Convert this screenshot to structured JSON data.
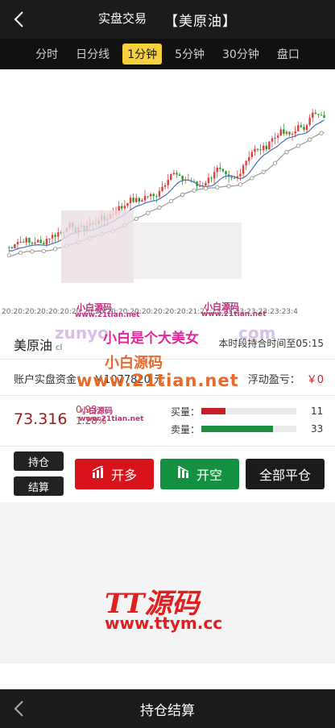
{
  "header": {
    "title": "实盘交易",
    "product": "【美原油】"
  },
  "tabs": [
    {
      "label": "分时",
      "active": false
    },
    {
      "label": "日分线",
      "active": false
    },
    {
      "label": "1分钟",
      "active": true
    },
    {
      "label": "5分钟",
      "active": false
    },
    {
      "label": "30分钟",
      "active": false
    },
    {
      "label": "盘口",
      "active": false
    }
  ],
  "chart_data": {
    "type": "candlestick",
    "x_tick_label_text": "20:20:20:20:20:20:20:20:20:20:20:20:20:20:20:20:21:21:23:23:23:23:23:23:23:4",
    "up_color": "#e03d3d",
    "down_color": "#2a9a2a"
  },
  "watermarks": {
    "a": "小白源码",
    "b": "www.21tian.net",
    "c": "zunyo",
    "d": "小白是个大美女",
    "e": "com",
    "f": "小白源码",
    "g": "www.21tian.net",
    "h": "小白源码",
    "i": "www.21tian.net",
    "j": "小白源码",
    "k": "www.21tian.net",
    "l": "TT源码",
    "m": "www.ttym.cc"
  },
  "info": {
    "name": "美原油",
    "code": "cl",
    "hold_time": "本时段持合时间至05:15",
    "fund_label": "账户实盘资金：",
    "fund_value": "￥1077820 元",
    "pnl_label": "浮动盈亏：",
    "pnl_value": "￥0",
    "price": "73.316",
    "change": "0.93",
    "change_pct": "1.28%",
    "buy_label": "买量：",
    "buy_value": "11",
    "buy_ratio": 0.25,
    "sell_label": "卖量：",
    "sell_value": "33",
    "sell_ratio": 0.75
  },
  "buttons": {
    "hold": "持仓",
    "settle": "结算",
    "long": "开多",
    "short": "开空",
    "close_all": "全部平仓"
  },
  "footer": {
    "title": "持仓结算"
  },
  "colors": {
    "accent_yellow": "#f5d13d",
    "long_red": "#d8131c",
    "short_green": "#139141",
    "dark": "#1b1b1b"
  }
}
